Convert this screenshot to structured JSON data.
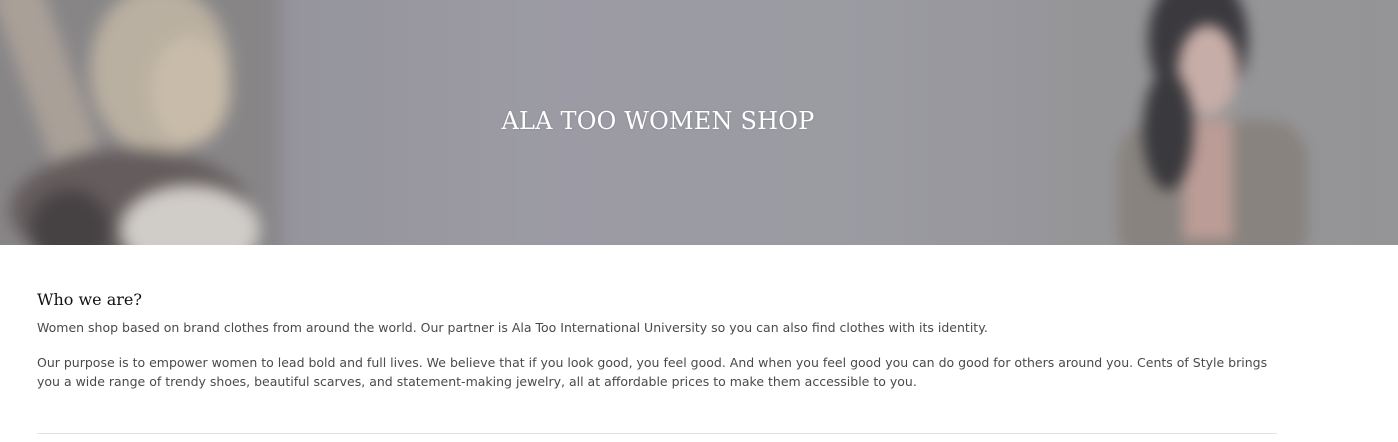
{
  "hero": {
    "title": "ALA TOO WOMEN SHOP"
  },
  "about": {
    "heading": "Who we are?",
    "paragraphs": [
      "Women shop based on brand clothes from around the world. Our partner is Ala Too International University so you can also find clothes with its identity.",
      "Our purpose is to empower women to lead bold and full lives. We believe that if you look good, you feel good. And when you feel good you can do good for others around you. Cents of Style brings you a wide range of trendy shoes, beautiful scarves, and statement-making jewelry, all at affordable prices to make them accessible to you."
    ]
  },
  "colors": {
    "hero_text": "#ffffff",
    "heading_text": "#111111",
    "body_text": "#4a4a4a",
    "divider": "#e3e3e3"
  }
}
